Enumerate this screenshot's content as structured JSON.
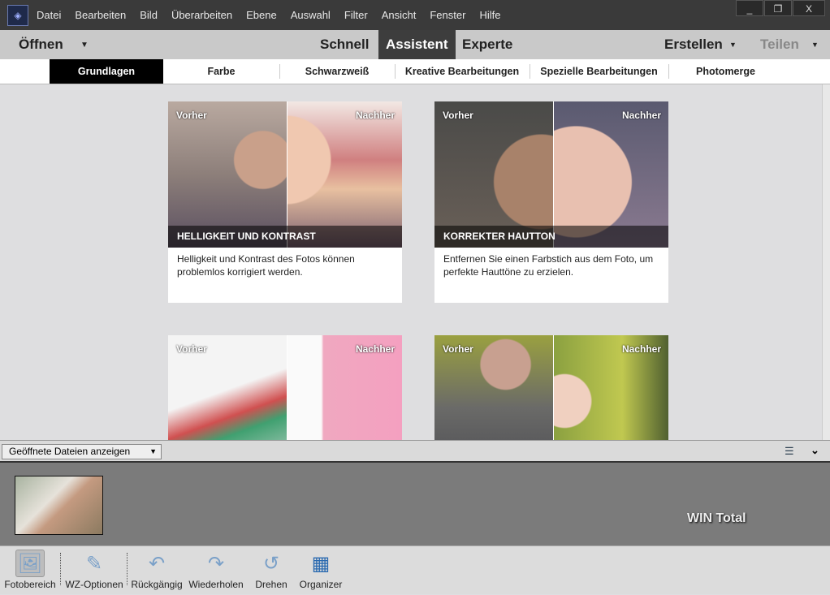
{
  "menu": [
    "Datei",
    "Bearbeiten",
    "Bild",
    "Überarbeiten",
    "Ebene",
    "Auswahl",
    "Filter",
    "Ansicht",
    "Fenster",
    "Hilfe"
  ],
  "window": {
    "minimize": "_",
    "restore": "❐",
    "close": "X"
  },
  "modebar": {
    "open": "Öffnen",
    "quick": "Schnell",
    "guided": "Assistent",
    "expert": "Experte",
    "create": "Erstellen",
    "share": "Teilen"
  },
  "tabs": [
    "Grundlagen",
    "Farbe",
    "Schwarzweiß",
    "Kreative Bearbeitungen",
    "Spezielle Bearbeitungen",
    "Photomerge"
  ],
  "cards": [
    {
      "before": "Vorher",
      "after": "Nachher",
      "title": "HELLIGKEIT UND KONTRAST",
      "desc": "Helligkeit und Kontrast des Fotos können problemlos korrigiert werden."
    },
    {
      "before": "Vorher",
      "after": "Nachher",
      "title": "KORREKTER HAUTTON",
      "desc": "Entfernen Sie einen Farbstich aus dem Foto, um perfekte Hauttöne zu erzielen."
    },
    {
      "before": "Vorher",
      "after": "Nachher"
    },
    {
      "before": "Vorher",
      "after": "Nachher"
    }
  ],
  "panel": {
    "select": "Geöffnete Dateien anzeigen"
  },
  "watermark": "WIN Total",
  "tools": [
    "Fotobereich",
    "WZ-Optionen",
    "Rückgängig",
    "Wiederholen",
    "Drehen",
    "Organizer"
  ]
}
